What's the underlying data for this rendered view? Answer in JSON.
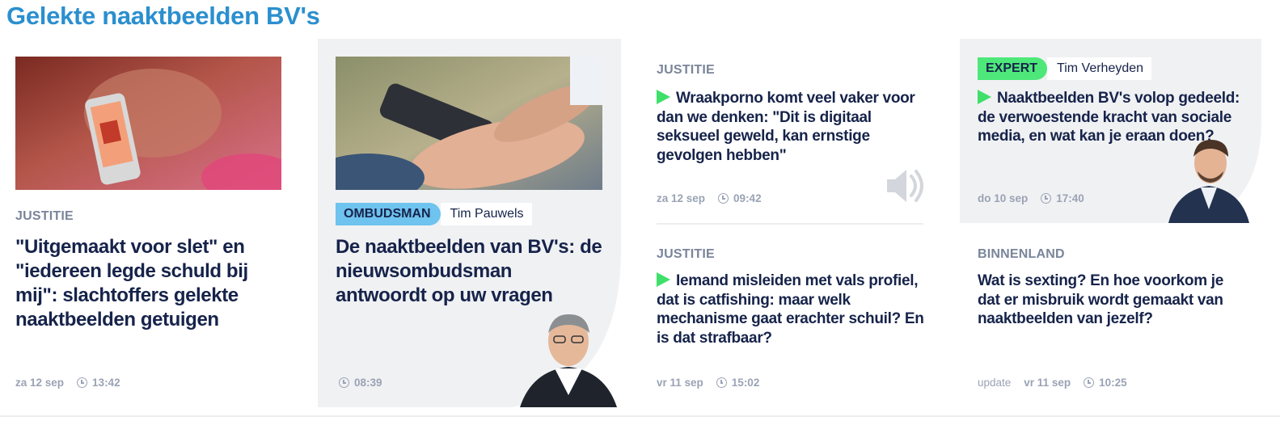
{
  "section": {
    "title": "Gelekte naaktbeelden BV's"
  },
  "articles": [
    {
      "kicker": "JUSTITIE",
      "headline": "\"Uitgemaakt voor slet\" en \"iedereen legde schuld bij mij\": slachtoffers gelekte naaktbeelden getuigen",
      "date": "za 12 sep",
      "time": "13:42"
    },
    {
      "tag": "OMBUDSMAN",
      "author": "Tim Pauwels",
      "headline": "De naaktbeelden van BV's: de nieuwsombudsman antwoordt op uw vragen",
      "time": "08:39"
    },
    {
      "kicker": "JUSTITIE",
      "headline": "Wraakporno komt veel vaker voor dan we denken: \"Dit is digitaal seksueel geweld, kan ernstige gevolgen hebben\"",
      "date": "za 12 sep",
      "time": "09:42",
      "icon": "speaker-icon"
    },
    {
      "tag": "EXPERT",
      "author": "Tim Verheyden",
      "headline": "Naaktbeelden BV's volop gedeeld: de verwoestende kracht van sociale media, en wat kan je eraan doen?",
      "date": "do 10 sep",
      "time": "17:40"
    },
    {
      "kicker": "JUSTITIE",
      "headline": "Iemand misleiden met vals profiel, dat is catfishing: maar welk mechanisme gaat erachter schuil? En is dat strafbaar?",
      "date": "vr 11 sep",
      "time": "15:02"
    },
    {
      "kicker": "BINNENLAND",
      "headline": "Wat is sexting? En hoe voorkom je dat er misbruik wordt gemaakt van naaktbeelden van jezelf?",
      "update": "update",
      "date": "vr 11 sep",
      "time": "10:25"
    }
  ],
  "colors": {
    "title": "#2b8fcf",
    "headline": "#16234a",
    "ombudsman_tag": "#6ec3ef",
    "expert_tag": "#4ee87a",
    "play": "#3ee06a",
    "card_bg": "#f0f1f3"
  }
}
